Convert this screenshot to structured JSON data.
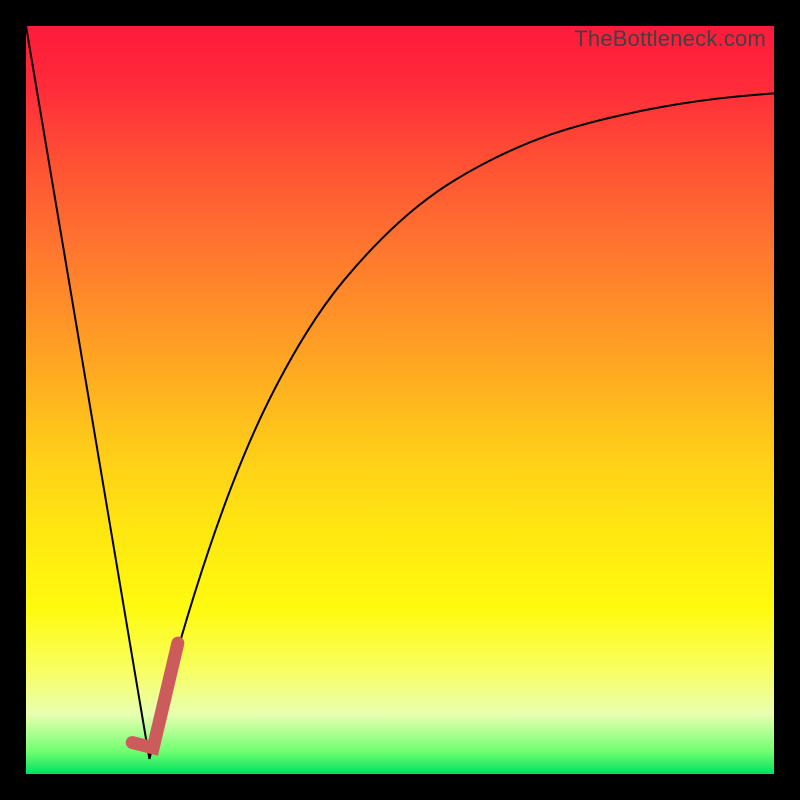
{
  "watermark": "TheBottleneck.com",
  "chart_data": {
    "type": "line",
    "title": "",
    "xlabel": "",
    "ylabel": "",
    "xlim": [
      0,
      100
    ],
    "ylim": [
      0,
      100
    ],
    "series": [
      {
        "name": "left-falling-line",
        "x": [
          0,
          16.5
        ],
        "y": [
          100,
          2
        ]
      },
      {
        "name": "right-rising-curve",
        "x": [
          16.5,
          20,
          25,
          30,
          35,
          40,
          45,
          50,
          55,
          60,
          65,
          70,
          75,
          80,
          85,
          90,
          95,
          100
        ],
        "y": [
          2,
          16,
          32,
          45,
          55,
          63,
          69,
          74,
          78,
          81,
          83.5,
          85.5,
          87,
          88.2,
          89.2,
          90,
          90.6,
          91
        ]
      }
    ],
    "highlight": {
      "name": "safe-region-marker",
      "color": "#cc5c5c",
      "points": [
        {
          "x": 14.2,
          "y": 4.2
        },
        {
          "x": 17.0,
          "y": 3.5
        },
        {
          "x": 20.3,
          "y": 17.5
        }
      ]
    },
    "background_gradient": {
      "top": "#ff1a3c",
      "mid": "#ffe810",
      "bottom": "#00e060"
    }
  }
}
